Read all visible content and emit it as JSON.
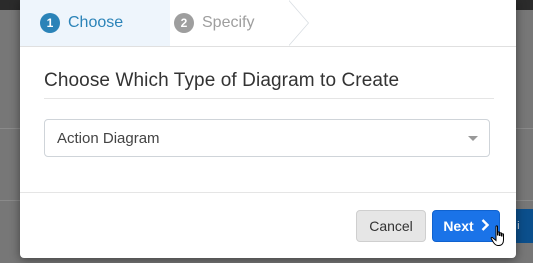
{
  "wizard": {
    "steps": [
      {
        "number": "1",
        "label": "Choose",
        "state": "active"
      },
      {
        "number": "2",
        "label": "Specify",
        "state": "inactive"
      }
    ]
  },
  "modal": {
    "heading": "Choose Which Type of Diagram to Create",
    "diagram_type_select": {
      "selected": "Action Diagram"
    }
  },
  "footer": {
    "cancel_label": "Cancel",
    "next_label": "Next",
    "next_icon": "chevron-right-icon"
  },
  "background": {
    "partial_button_text": "l- i"
  },
  "colors": {
    "active_step": "#2b83b8",
    "inactive_step": "#9e9e9e",
    "primary_button": "#1a73e8"
  }
}
